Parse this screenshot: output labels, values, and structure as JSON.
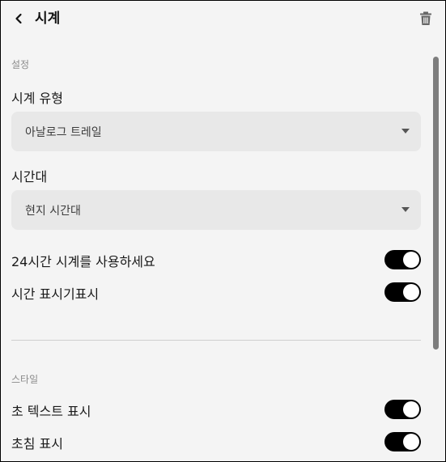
{
  "header": {
    "back_icon": "chevron-left-icon",
    "title": "시계",
    "delete_icon": "trash-icon"
  },
  "settings_section": {
    "label": "설정",
    "clock_type": {
      "label": "시계 유형",
      "selected": "아날로그 트레일"
    },
    "timezone": {
      "label": "시간대",
      "selected": "현지 시간대"
    },
    "toggles": [
      {
        "label": "24시간 시계를 사용하세요",
        "on": true
      },
      {
        "label": "시간 표시기표시",
        "on": true
      }
    ]
  },
  "style_section": {
    "label": "스타일",
    "toggles": [
      {
        "label": "초 텍스트 표시",
        "on": true
      },
      {
        "label": "초침 표시",
        "on": true
      }
    ]
  },
  "colors": {
    "background": "#f4f4f4",
    "select_bg": "#e8e8e8",
    "toggle_on": "#000000",
    "scrollbar": "#7d7d7d"
  }
}
